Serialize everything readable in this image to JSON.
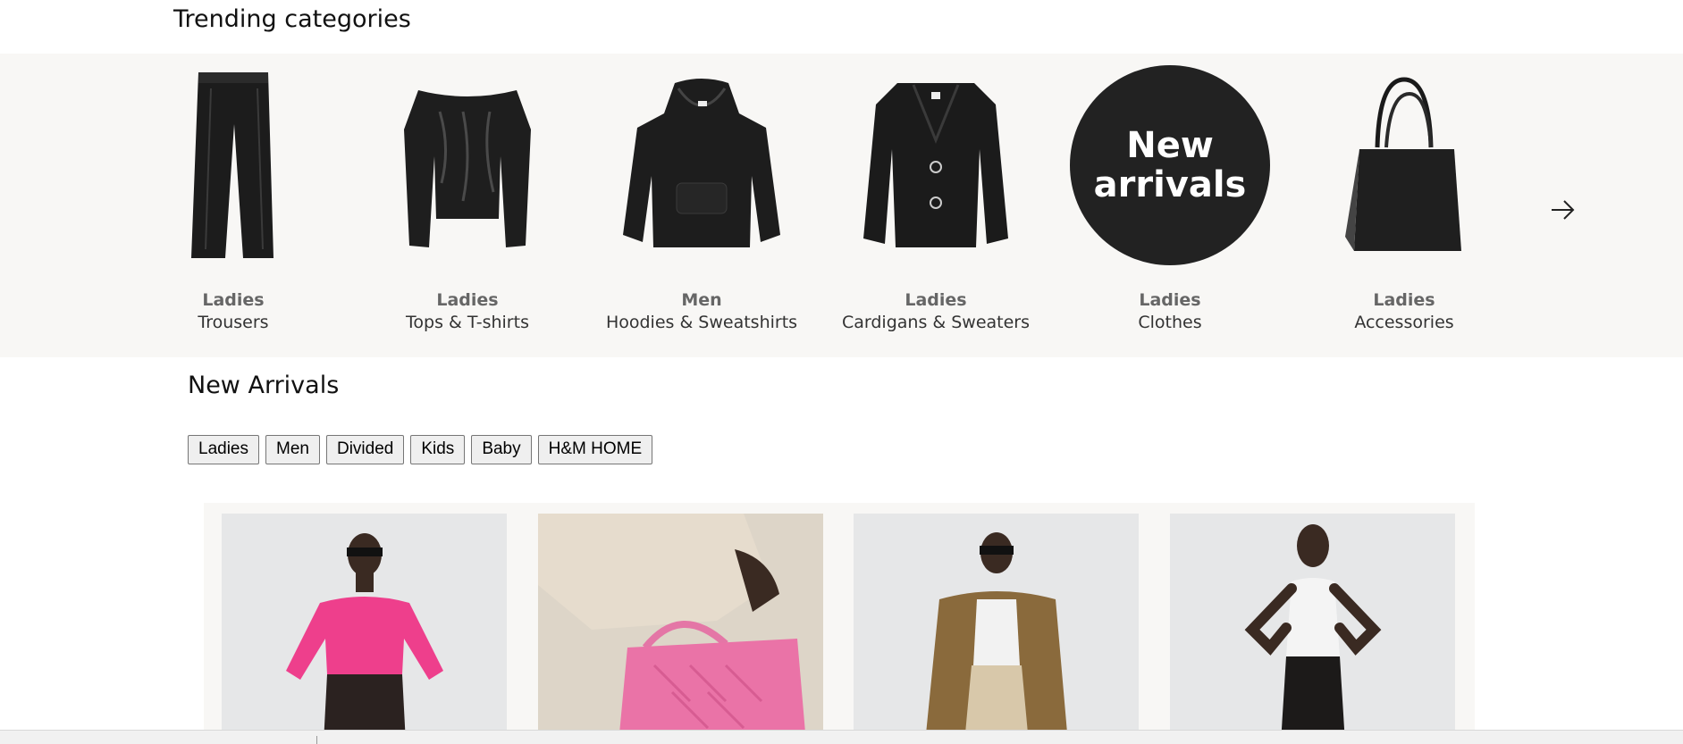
{
  "trending": {
    "title": "Trending categories",
    "categories": [
      {
        "dept": "Ladies",
        "name": "Trousers",
        "icon": "trousers-image"
      },
      {
        "dept": "Ladies",
        "name": "Tops & T-shirts",
        "icon": "satin-top-image"
      },
      {
        "dept": "Men",
        "name": "Hoodies & Sweatshirts",
        "icon": "hoodie-image"
      },
      {
        "dept": "Ladies",
        "name": "Cardigans & Sweaters",
        "icon": "cardigan-image"
      },
      {
        "dept": "Ladies",
        "name": "Clothes",
        "badge_line1": "New",
        "badge_line2": "arrivals"
      },
      {
        "dept": "Ladies",
        "name": "Accessories",
        "icon": "tote-bag-image"
      }
    ],
    "next_icon": "arrow-right-icon"
  },
  "new_arrivals": {
    "title": "New Arrivals",
    "filters": [
      "Ladies",
      "Men",
      "Divided",
      "Kids",
      "Baby",
      "H&M HOME"
    ]
  },
  "colors": {
    "band_background": "#f8f7f5",
    "badge": "#222222",
    "pink": "#ee3f8c"
  }
}
